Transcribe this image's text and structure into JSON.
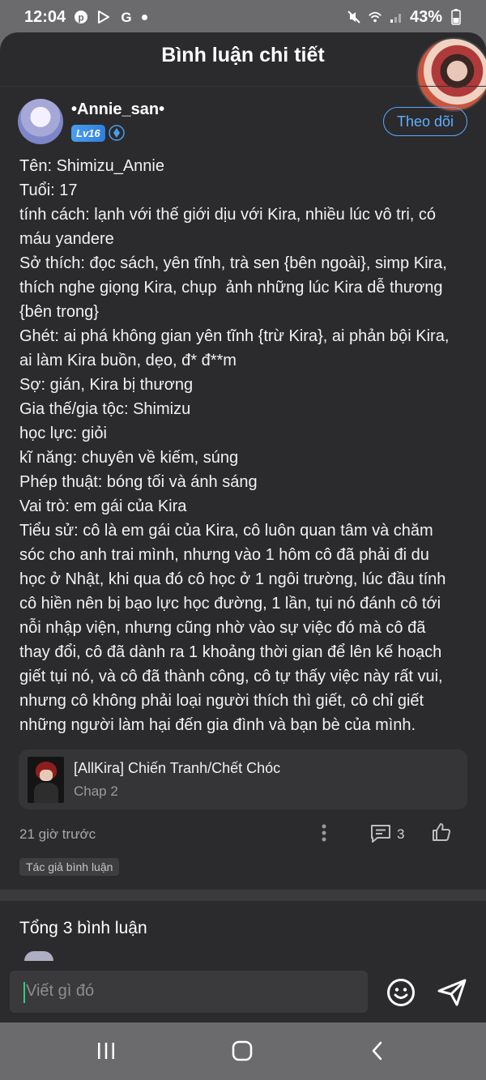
{
  "status_bar": {
    "time": "12:04",
    "battery": "43%",
    "icons": [
      "pinterest-icon",
      "play-store-icon",
      "google-icon",
      "dot-icon",
      "mute-icon",
      "wifi-icon",
      "signal-icon",
      "battery-icon"
    ]
  },
  "header": {
    "title": "Bình luận chi tiết"
  },
  "comment": {
    "username": "•Annie_san•",
    "level": "Lv16",
    "follow_label": "Theo dõi",
    "lines": [
      "Tên: Shimizu_Annie",
      "Tuổi: 17",
      "tính cách: lạnh với thế giới dịu với Kira, nhiều lúc vô tri, có",
      "máu yandere",
      "Sở thích: đọc sách, yên tĩnh, trà sen {bên ngoài}, simp Kira,",
      "thích nghe giọng Kira, chụp  ảnh những lúc Kira dễ thương",
      "{bên trong}",
      "Ghét: ai phá không gian yên tĩnh {trừ Kira}, ai phản bội Kira,",
      "ai làm Kira buồn, dẹo, đ* đ**m",
      "Sợ: gián, Kira bị thương",
      "Gia thế/gia tộc: Shimizu",
      "học lực: giỏi",
      "kĩ năng: chuyên về kiếm, súng",
      "Phép thuật: bóng tối và ánh sáng",
      "Vai trò: em gái của Kira",
      "Tiểu sử: cô là em gái của Kira, cô luôn quan tâm và chăm",
      "sóc cho anh trai mình, nhưng vào 1 hôm cô đã phải đi du",
      "học ở Nhật, khi qua đó cô học ở 1 ngôi trường, lúc đầu tính",
      "cô hiền nên bị bạo lực học đường, 1 lần, tụi nó đánh cô tới",
      "nỗi nhập viện, nhưng cũng nhờ vào sự việc đó mà cô đã",
      "thay đổi, cô đã dành ra 1 khoảng thời gian để lên kế hoạch",
      "giết tụi nó, và cô đã thành công, cô tự thấy việc này rất vui,",
      "nhưng cô không phải loại người thích thì giết, cô chỉ giết",
      "những người làm hại đến gia đình và bạn bè của mình."
    ],
    "story_card": {
      "title": "[AllKira] Chiến Tranh/Chết Chóc",
      "chapter": "Chap 2"
    },
    "time": "21 giờ trước",
    "reply_count": "3",
    "author_tag": "Tác giả bình luận"
  },
  "comments_section": {
    "total_label": "Tổng 3 bình luận"
  },
  "input": {
    "placeholder": "Viết gì đó"
  },
  "colors": {
    "sheet_bg": "#2b2b2d",
    "accent_blue": "#5aa7ff",
    "text_primary": "#f2f2f2",
    "text_muted": "#a9a9ab",
    "caret_green": "#2bd07a"
  }
}
